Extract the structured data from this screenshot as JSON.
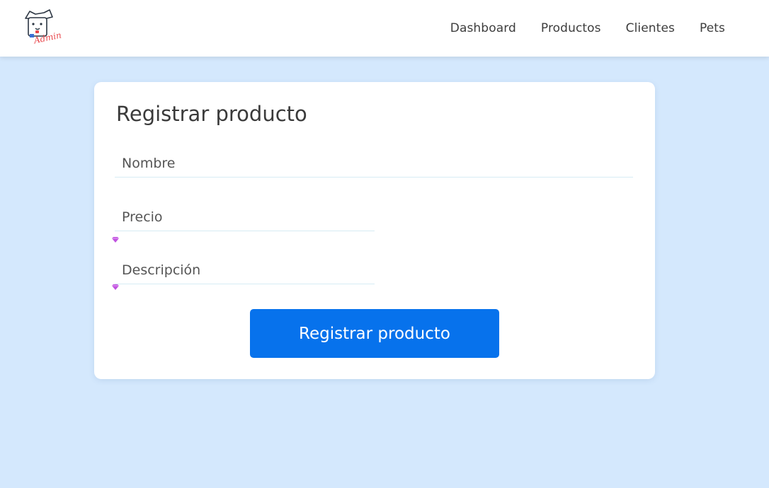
{
  "header": {
    "logo": {
      "icon": "dog-admin-logo",
      "text": "Admin"
    },
    "nav": [
      {
        "label": "Dashboard"
      },
      {
        "label": "Productos"
      },
      {
        "label": "Clientes"
      },
      {
        "label": "Pets"
      }
    ]
  },
  "form": {
    "title": "Registrar producto",
    "fields": {
      "nombre": {
        "placeholder": "Nombre",
        "value": ""
      },
      "precio": {
        "placeholder": "Precio",
        "value": ""
      },
      "descripcion": {
        "placeholder": "Descripción",
        "value": ""
      }
    },
    "submit_label": "Registrar producto"
  },
  "colors": {
    "background": "#d4e8fd",
    "accent": "#0772ec",
    "logo_text": "#e8454a",
    "marker": "#c052e0"
  }
}
